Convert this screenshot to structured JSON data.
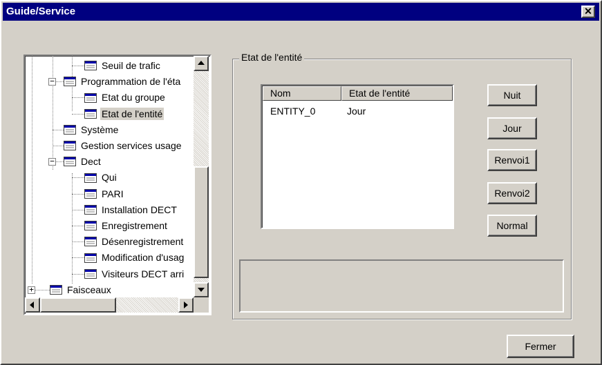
{
  "window": {
    "title": "Guide/Service",
    "close_glyph": "✕"
  },
  "tree": {
    "items": [
      {
        "label": "Seuil de trafic",
        "icon": "list-icon"
      },
      {
        "label": "Programmation de l'éta",
        "icon": "list-icon",
        "expander": "−"
      },
      {
        "label": "Etat du groupe",
        "icon": "list-icon"
      },
      {
        "label": "Etat de l'entité",
        "icon": "list-icon",
        "selected": true
      },
      {
        "label": "Système",
        "icon": "list-icon"
      },
      {
        "label": "Gestion services usage",
        "icon": "list-icon"
      },
      {
        "label": "Dect",
        "icon": "list-icon",
        "expander": "−"
      },
      {
        "label": "Qui",
        "icon": "list-icon"
      },
      {
        "label": "PARI",
        "icon": "list-icon"
      },
      {
        "label": "Installation DECT",
        "icon": "list-icon"
      },
      {
        "label": "Enregistrement",
        "icon": "list-icon"
      },
      {
        "label": "Désenregistrement",
        "icon": "list-icon"
      },
      {
        "label": "Modification d'usag",
        "icon": "list-icon"
      },
      {
        "label": "Visiteurs DECT arri",
        "icon": "list-icon"
      },
      {
        "label": "Faisceaux",
        "icon": "list-icon",
        "expander": "+"
      }
    ]
  },
  "group": {
    "title": "Etat de l'entité",
    "list": {
      "columns": [
        "Nom",
        "Etat de l'entité"
      ],
      "rows": [
        [
          "ENTITY_0",
          "Jour"
        ]
      ]
    },
    "buttons": {
      "nuit": "Nuit",
      "jour": "Jour",
      "renvoi1": "Renvoi1",
      "renvoi2": "Renvoi2",
      "normal": "Normal"
    }
  },
  "footer": {
    "close_label": "Fermer"
  },
  "colors": {
    "titlebar": "#000080",
    "face": "#d4d0c8",
    "icon_blue": "#0000a8"
  }
}
